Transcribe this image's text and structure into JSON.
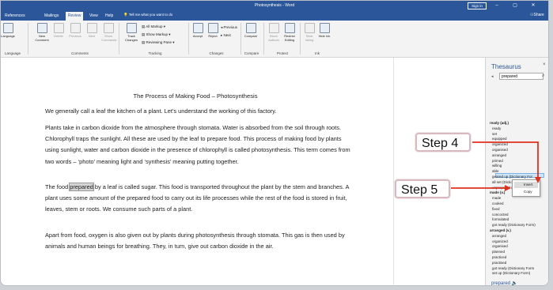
{
  "titlebar": {
    "doc_title": "Photosynthesis - Word",
    "signin": "Sign in",
    "minimize": "–",
    "restore": "▢",
    "close": "✕"
  },
  "tabs": [
    {
      "label": "References"
    },
    {
      "label": "Mailings"
    },
    {
      "label": "Review"
    },
    {
      "label": "View"
    },
    {
      "label": "Help"
    }
  ],
  "active_tab": "Review",
  "tell_me": "Tell me what you want to do",
  "share": "Share",
  "ribbon": {
    "language": "Language",
    "new_comment": "New Comment",
    "delete": "Delete",
    "previous": "Previous",
    "next": "Next",
    "show_comments": "Show Comments",
    "track_changes": "Track Changes",
    "all_markup": "All Markup",
    "show_markup": "Show Markup",
    "reviewing_pane": "Reviewing Pane",
    "accept": "Accept",
    "reject": "Reject",
    "previous_change": "Previous",
    "next_change": "Next",
    "compare": "Compare",
    "block_authors": "Block Authors",
    "restrict_editing": "Restrict Editing",
    "start_inking": "Start Inking",
    "hide_ink": "Hide Ink",
    "groups": {
      "language": "Language",
      "comments": "Comments",
      "tracking": "Tracking",
      "changes": "Changes",
      "compare": "Compare",
      "protect": "Protect",
      "ink": "Ink"
    }
  },
  "document": {
    "heading": "The Process of Making Food – Photosynthesis",
    "paragraphs": [
      "We generally call a leaf the kitchen of a plant. Let’s understand the working of this factory.",
      "Plants take in carbon dioxide from the atmosphere through stomata. Water is absorbed from the soil through roots. Chlorophyll traps the sunlight. All these are used by the leaf to prepare food. This process of making food by plants using sunlight, water and carbon dioxide in the presence of chlorophyll is called photosynthesis. This term comes from two words – ‘photo’ meaning light and ‘synthesis’ meaning putting together.",
      "Apart from food, oxygen is also given out by plants during photosynthesis through stomata. This gas is then used by animals and human beings for breathing. They, in turn, give out carbon dioxide in the air."
    ],
    "p3_before": "The food ",
    "p3_highlight": "prepared",
    "p3_after": " by a leaf is called sugar. This food is transported throughout the plant by the stem and branches. A plant uses some amount of the prepared food to carry out its life processes while the rest of the food is stored in fruit, leaves, stem or roots. We consume such parts of a plant."
  },
  "thesaurus": {
    "title": "Thesaurus",
    "close": "×",
    "search_value": "prepared",
    "words": [
      {
        "t": "ready (adj.)",
        "cat": true
      },
      {
        "t": "ready"
      },
      {
        "t": "set"
      },
      {
        "t": "equipped"
      },
      {
        "t": "organized"
      },
      {
        "t": "organised"
      },
      {
        "t": "arranged"
      },
      {
        "t": "primed"
      },
      {
        "t": "willing"
      },
      {
        "t": "able"
      },
      {
        "t": "geared up (Dictionary For"
      },
      {
        "t": "all set (Dictionary Form)"
      },
      {
        "t": "unprepared (Antonym)"
      },
      {
        "t": "made (v.)",
        "cat": true
      },
      {
        "t": "made"
      },
      {
        "t": "cooked"
      },
      {
        "t": "fixed"
      },
      {
        "t": "concocted"
      },
      {
        "t": "formulated"
      },
      {
        "t": "got ready (Dictionary Form)"
      },
      {
        "t": "arranged (v.)",
        "cat": true
      },
      {
        "t": "arranged"
      },
      {
        "t": "organized"
      },
      {
        "t": "organised"
      },
      {
        "t": "planned"
      },
      {
        "t": "practiced"
      },
      {
        "t": "practised"
      },
      {
        "t": "got ready (Dictionary Form"
      },
      {
        "t": "set up (Dictionary Form)"
      }
    ],
    "context_menu": [
      "Insert",
      "Copy"
    ],
    "footer_word": "prepared",
    "footer_icon": "speaker-icon"
  },
  "annotations": [
    {
      "label": "Step 4"
    },
    {
      "label": "Step 5"
    }
  ],
  "colors": {
    "word_blue": "#2b579a",
    "arrow_red": "#e0301e",
    "callout_border": "#d9b9c0"
  }
}
